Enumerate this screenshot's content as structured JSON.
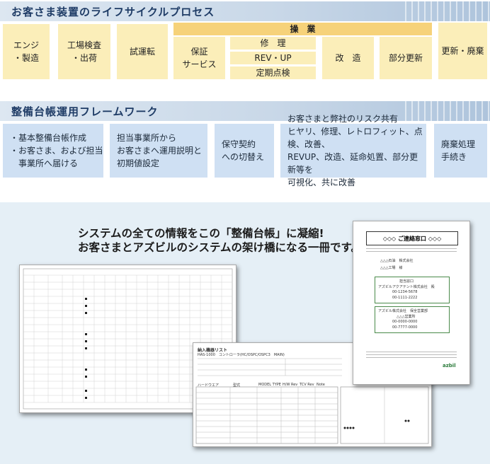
{
  "lifecycle": {
    "title": "お客さま装置のライフサイクルプロセス",
    "operation_header": "操　業",
    "stages": [
      "エンジ\n・製造",
      "工場検査\n・出荷",
      "試運転",
      "保証\nサービス"
    ],
    "operation_items": [
      "修　理",
      "REV・UP",
      "定期点検"
    ],
    "after": [
      "改　造",
      "部分更新",
      "更新・廃棄"
    ]
  },
  "framework": {
    "title": "整備台帳運用フレームワーク",
    "box1": [
      "・基本整備台帳作成",
      "・お客さま、および担当",
      "　事業所へ届ける"
    ],
    "box2": [
      "担当事業所から",
      "お客さまへ運用説明と",
      "初期値設定"
    ],
    "box3": [
      "保守契約",
      "への切替え"
    ],
    "box4": [
      "お客さまと弊社のリスク共有",
      "ヒヤリ、修理、レトロフィット、点検、改善、",
      "REVUP、改造、延命処置、部分更新等を",
      "可視化、共に改善"
    ],
    "box5": [
      "廃棄処理",
      "手続き"
    ]
  },
  "system": {
    "headline1": "システムの全ての情報をこの「整備台帳」に凝縮!",
    "headline2": "お客さまとアズビルのシステムの架け橋になる一冊です。"
  },
  "contact_doc": {
    "title": "◇◇◇ ご連絡窓口 ◇◇◇",
    "customer_name": "△△△石油　株式会社",
    "customer_dept": "△△△工場　様",
    "section1_head": "担当窓口",
    "section1_company": "アズビルアクアテント株式会社　殿",
    "phone1": "00-1234-5678",
    "fax1": "00-1111-2222",
    "section2_head": "アズビル株式会社　保全営業部",
    "section2_company": "△△△営業所",
    "phone2": "00-0000-0000",
    "fax2": "00-7777-0000",
    "logo": "azbil"
  },
  "equipment_doc": {
    "title": "納入機器リスト",
    "subtitle": "HAS-1000　コントローラ(HC/OSPC/OSPC3　MAIN)",
    "table_headers": [
      "ハードウエア",
      "型式",
      "MODEL TYPE",
      "H/W Rev",
      "TCV Rev",
      "Note"
    ]
  }
}
